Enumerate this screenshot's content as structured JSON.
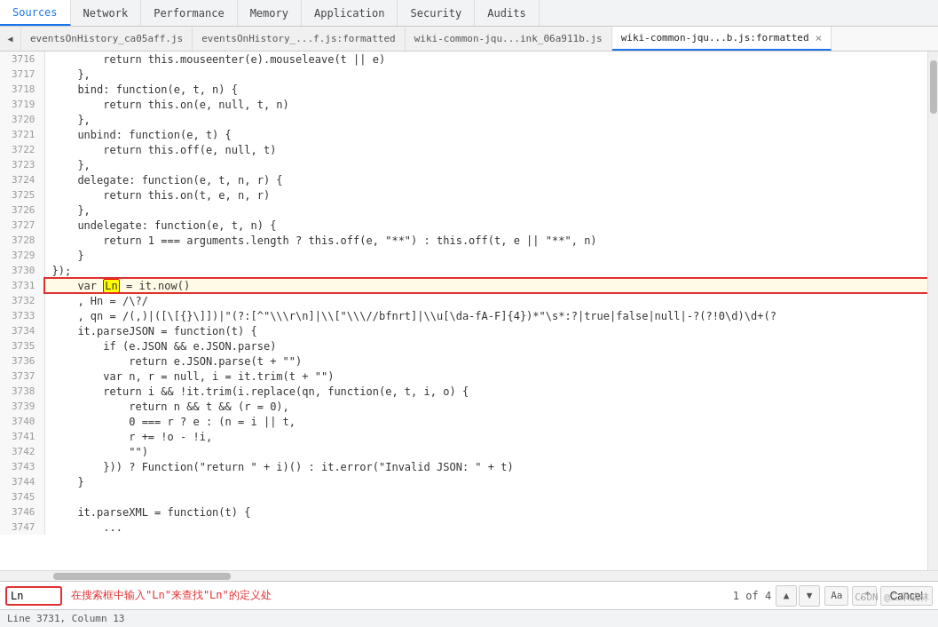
{
  "nav": {
    "tabs": [
      {
        "label": "Sources",
        "active": true
      },
      {
        "label": "Network",
        "active": false
      },
      {
        "label": "Performance",
        "active": false
      },
      {
        "label": "Memory",
        "active": false
      },
      {
        "label": "Application",
        "active": false
      },
      {
        "label": "Security",
        "active": false
      },
      {
        "label": "Audits",
        "active": false
      }
    ]
  },
  "file_tabs": [
    {
      "label": "eventsOnHistory_ca05aff.js",
      "active": false
    },
    {
      "label": "eventsOnHistory_...f.js:formatted",
      "active": false
    },
    {
      "label": "wiki-common-jqu...ink_06a911b.js",
      "active": false
    },
    {
      "label": "wiki-common-jqu...b.js:formatted",
      "active": true,
      "closeable": true
    }
  ],
  "code": {
    "lines": [
      {
        "num": 3716,
        "content": "        return this.mouseenter(e).mouseleave(t || e)",
        "highlight": false
      },
      {
        "num": 3717,
        "content": "    },",
        "highlight": false
      },
      {
        "num": 3718,
        "content": "    bind: function(e, t, n) {",
        "highlight": false
      },
      {
        "num": 3719,
        "content": "        return this.on(e, null, t, n)",
        "highlight": false
      },
      {
        "num": 3720,
        "content": "    },",
        "highlight": false
      },
      {
        "num": 3721,
        "content": "    unbind: function(e, t) {",
        "highlight": false
      },
      {
        "num": 3722,
        "content": "        return this.off(e, null, t)",
        "highlight": false
      },
      {
        "num": 3723,
        "content": "    },",
        "highlight": false
      },
      {
        "num": 3724,
        "content": "    delegate: function(e, t, n, r) {",
        "highlight": false
      },
      {
        "num": 3725,
        "content": "        return this.on(t, e, n, r)",
        "highlight": false
      },
      {
        "num": 3726,
        "content": "    },",
        "highlight": false
      },
      {
        "num": 3727,
        "content": "    undelegate: function(e, t, n) {",
        "highlight": false
      },
      {
        "num": 3728,
        "content": "        return 1 === arguments.length ? this.off(e, \"**\") : this.off(t, e || \"**\", n)",
        "highlight": false
      },
      {
        "num": 3729,
        "content": "    }",
        "highlight": false
      },
      {
        "num": 3730,
        "content": "});",
        "highlight": false
      },
      {
        "num": 3731,
        "content": "    var Ln = it.now()",
        "highlight": true
      },
      {
        "num": 3732,
        "content": "    , Hn = /\\?/",
        "highlight": false
      },
      {
        "num": 3733,
        "content": "    , qn = /(,)|([\\[{}\\]])|\"(?:[^\"\\\\\\r\\n]|\\\\[\"\\\\\\//bfnrt]|\\\\u[\\da-fA-F]{4})*\"\\s*:?|true|false|null|-?(?!0\\d)\\d+(?",
        "highlight": false
      },
      {
        "num": 3734,
        "content": "    it.parseJSON = function(t) {",
        "highlight": false
      },
      {
        "num": 3735,
        "content": "        if (e.JSON && e.JSON.parse)",
        "highlight": false
      },
      {
        "num": 3736,
        "content": "            return e.JSON.parse(t + \"\")",
        "highlight": false
      },
      {
        "num": 3737,
        "content": "        var n, r = null, i = it.trim(t + \"\")",
        "highlight": false
      },
      {
        "num": 3738,
        "content": "        return i && !it.trim(i.replace(qn, function(e, t, i, o) {",
        "highlight": false
      },
      {
        "num": 3739,
        "content": "            return n && t && (r = 0),",
        "highlight": false
      },
      {
        "num": 3740,
        "content": "            0 === r ? e : (n = i || t,",
        "highlight": false
      },
      {
        "num": 3741,
        "content": "            r += !o - !i,",
        "highlight": false
      },
      {
        "num": 3742,
        "content": "            \"\")",
        "highlight": false
      },
      {
        "num": 3743,
        "content": "        })) ? Function(\"return \" + i)() : it.error(\"Invalid JSON: \" + t)",
        "highlight": false
      },
      {
        "num": 3744,
        "content": "    }",
        "highlight": false
      },
      {
        "num": 3745,
        "content": "",
        "highlight": false
      },
      {
        "num": 3746,
        "content": "    it.parseXML = function(t) {",
        "highlight": false
      },
      {
        "num": 3747,
        "content": "        ...",
        "highlight": false
      }
    ]
  },
  "search": {
    "input_value": "Ln",
    "hint": "在搜索框中输入\"Ln\"来查找\"Ln\"的定义处",
    "count": "1 of 4",
    "up_label": "▲",
    "down_label": "▼",
    "match_case_label": "Aa",
    "regex_label": ".*",
    "cancel_label": "Cancel"
  },
  "status_bar": {
    "text": "Line 3731, Column 13"
  },
  "watermark": "CSDN @二禾成林"
}
